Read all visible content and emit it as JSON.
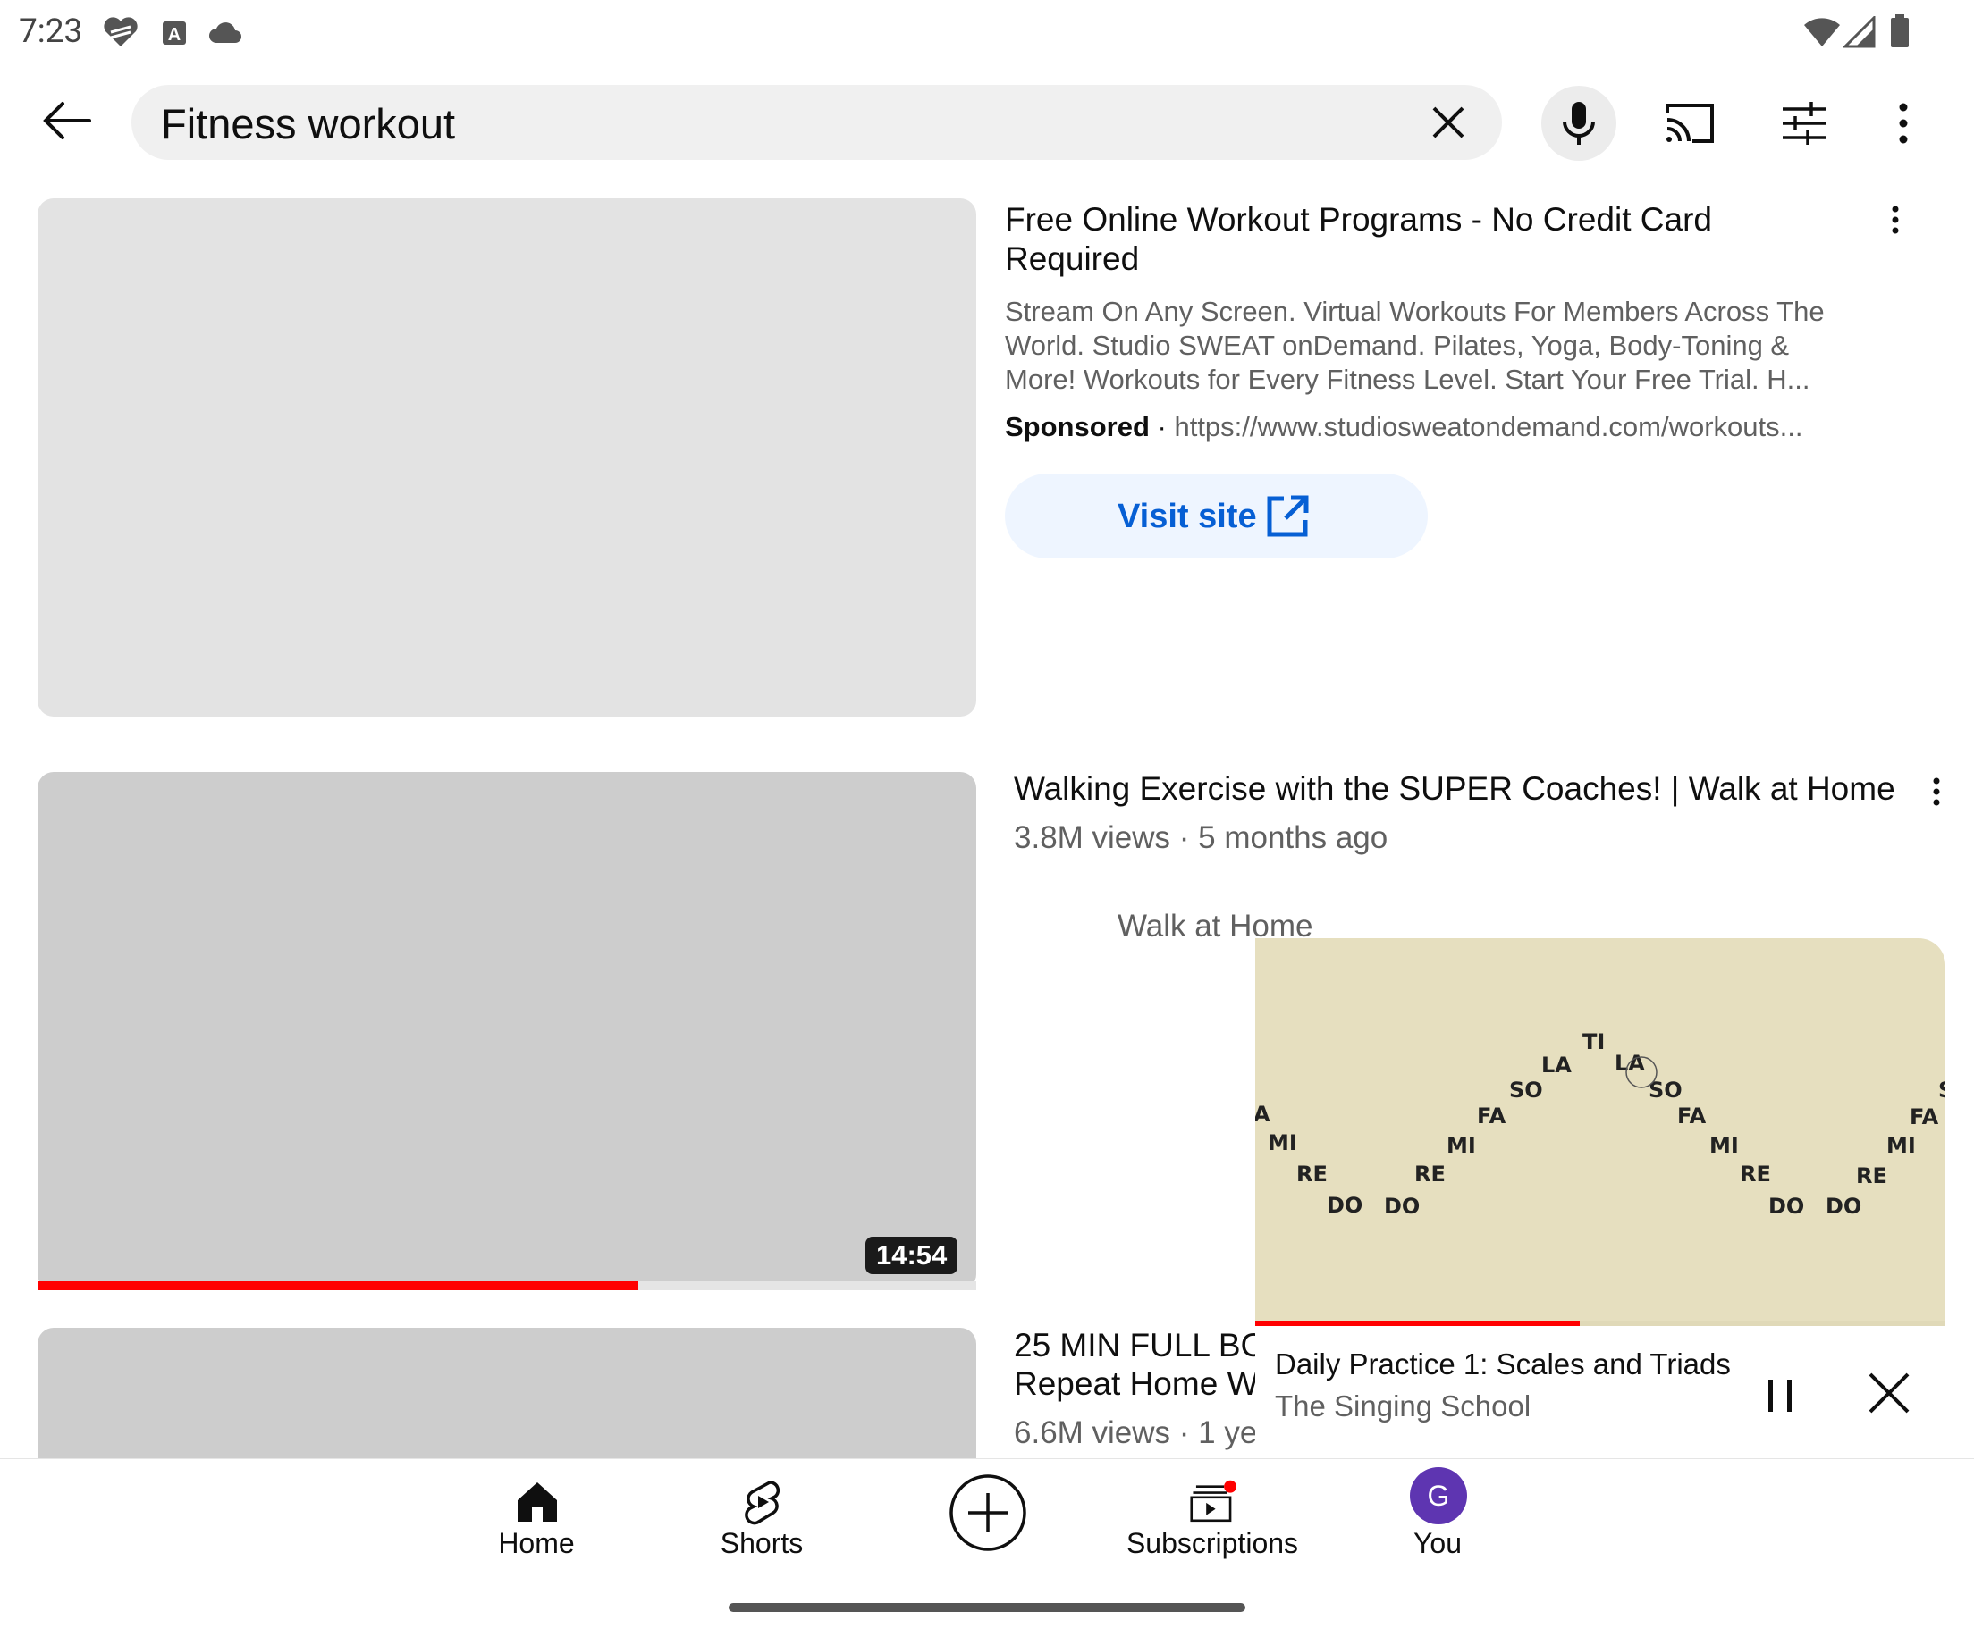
{
  "status_bar": {
    "time": "7:23"
  },
  "search": {
    "query": "Fitness workout"
  },
  "ad": {
    "title": "Free Online Workout Programs - No Credit Card Required",
    "description": "Stream On Any Screen. Virtual Workouts For Members Across The World. Studio SWEAT onDemand. Pilates, Yoga, Body-Toning & More! Workouts for Every Fitness Level. Start Your Free Trial. H...",
    "sponsored_label": "Sponsored",
    "separator": " · ",
    "url": "https://www.studiosweatondemand.com/workouts...",
    "cta_label": "Visit site",
    "cta_color": "#065fd4"
  },
  "videos": [
    {
      "title": "Walking Exercise with the SUPER Coaches! | Walk at Home",
      "meta": "3.8M views · 5 months ago",
      "channel": "Walk at Home",
      "duration": "14:54",
      "watched_fraction": 0.64
    },
    {
      "title_line1": "25 MIN FULL BO",
      "title_line2": "Repeat Home W",
      "meta": "6.6M views · 1 ye"
    }
  ],
  "mini_player": {
    "title": "Daily Practice 1: Scales and Triads",
    "channel": "The Singing School",
    "progress_fraction": 0.47,
    "solfege_labels": [
      "A",
      "MI",
      "RE",
      "DO",
      "DO",
      "RE",
      "MI",
      "FA",
      "SO",
      "LA",
      "TI",
      "LA",
      "SO",
      "FA",
      "MI",
      "RE",
      "DO",
      "DO",
      "RE",
      "MI",
      "FA",
      "S"
    ]
  },
  "bottom_nav": {
    "items": [
      {
        "label": "Home",
        "icon": "home-icon"
      },
      {
        "label": "Shorts",
        "icon": "shorts-icon"
      },
      {
        "label": "",
        "icon": "create-icon"
      },
      {
        "label": "Subscriptions",
        "icon": "subscriptions-icon"
      },
      {
        "label": "You",
        "icon": "avatar"
      }
    ],
    "avatar_letter": "G",
    "avatar_color": "#5e35b1",
    "accent": "#ff0000"
  }
}
